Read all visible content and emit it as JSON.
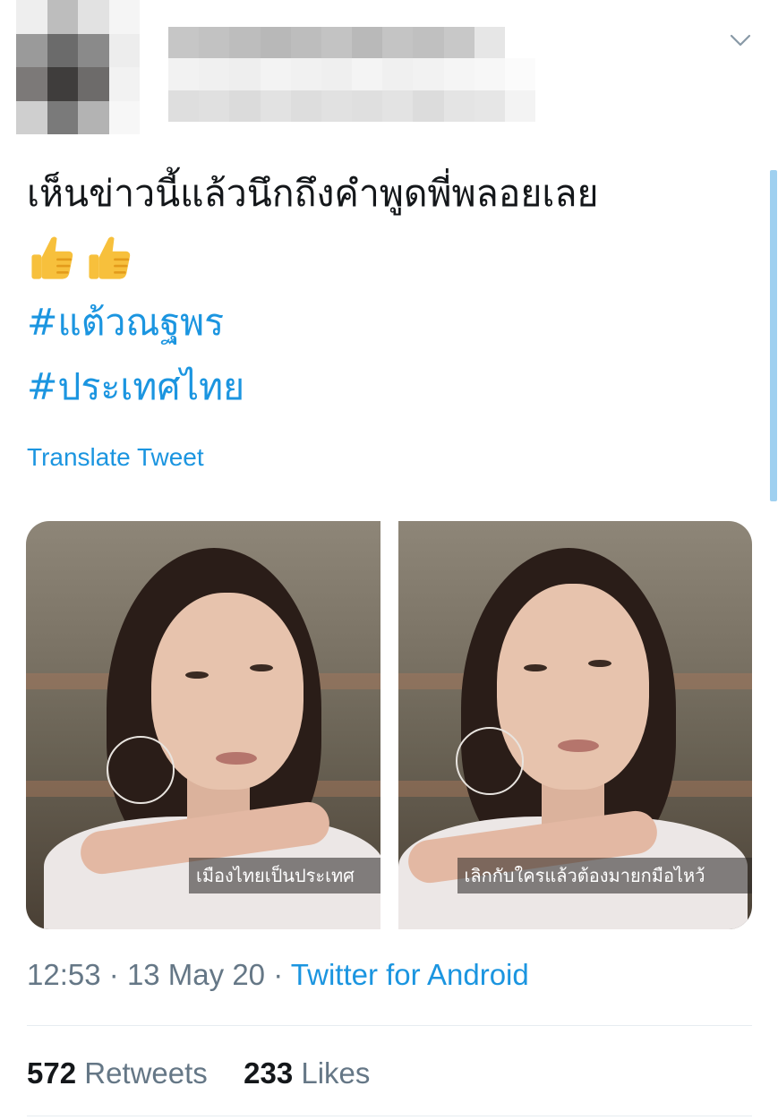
{
  "header": {
    "avatar_blocks": [
      "#eeeeee",
      "#bdbdbd",
      "#e2e2e2",
      "#f5f5f5",
      "#9a9a9a",
      "#6b6b6b",
      "#8a8a8a",
      "#ededed",
      "#7c7978",
      "#3f3d3c",
      "#6d6b6a",
      "#f2f2f2",
      "#cfcfcf",
      "#7a7a7a",
      "#b3b3b3",
      "#f7f7f7"
    ],
    "name_blocks": [
      "#c6c6c6",
      "#c2c2c2",
      "#bdbdbd",
      "#b8b8b8",
      "#bdbdbd",
      "#c3c3c3",
      "#b9b9b9",
      "#c4c4c4",
      "#c0c0c0",
      "#c8c8c8",
      "#e6e6e6",
      "#ffffff",
      "#f2f2f2",
      "#f0f0f0",
      "#eeeeee",
      "#f3f3f3",
      "#f1f1f1",
      "#efefef",
      "#f4f4f4",
      "#f0f0f0",
      "#f2f2f2",
      "#f5f5f5",
      "#f7f7f7",
      "#fbfbfb",
      "#dedede",
      "#e0e0e0",
      "#dbdbdb",
      "#e2e2e2",
      "#dddddd",
      "#e1e1e1",
      "#dfdfdf",
      "#e3e3e3",
      "#dcdcdc",
      "#e4e4e4",
      "#e6e6e6",
      "#f3f3f3"
    ],
    "menu_icon": "chevron-down-icon"
  },
  "tweet": {
    "text": "เห็นข่าวนี้แล้วนึกถึงคำพูดพี่พลอยเลย",
    "emoji": [
      "thumbs-up-icon",
      "thumbs-up-icon"
    ],
    "hashtags": [
      "#แต้วณฐพร",
      "#ประเทศไทย"
    ],
    "translate_label": "Translate Tweet"
  },
  "media": {
    "left_caption": "เมืองไทยเป็นประเทศ",
    "right_caption": "เลิกกับใครแล้วต้องมายกมือไหว้"
  },
  "meta": {
    "time": "12:53",
    "separator": "·",
    "date": "13 May 20",
    "source": "Twitter for Android"
  },
  "stats": {
    "retweets_count": "572",
    "retweets_label": "Retweets",
    "likes_count": "233",
    "likes_label": "Likes"
  },
  "colors": {
    "accent": "#1b95e0",
    "text": "#14171a",
    "muted": "#657786",
    "divider": "#e6ecf0"
  }
}
